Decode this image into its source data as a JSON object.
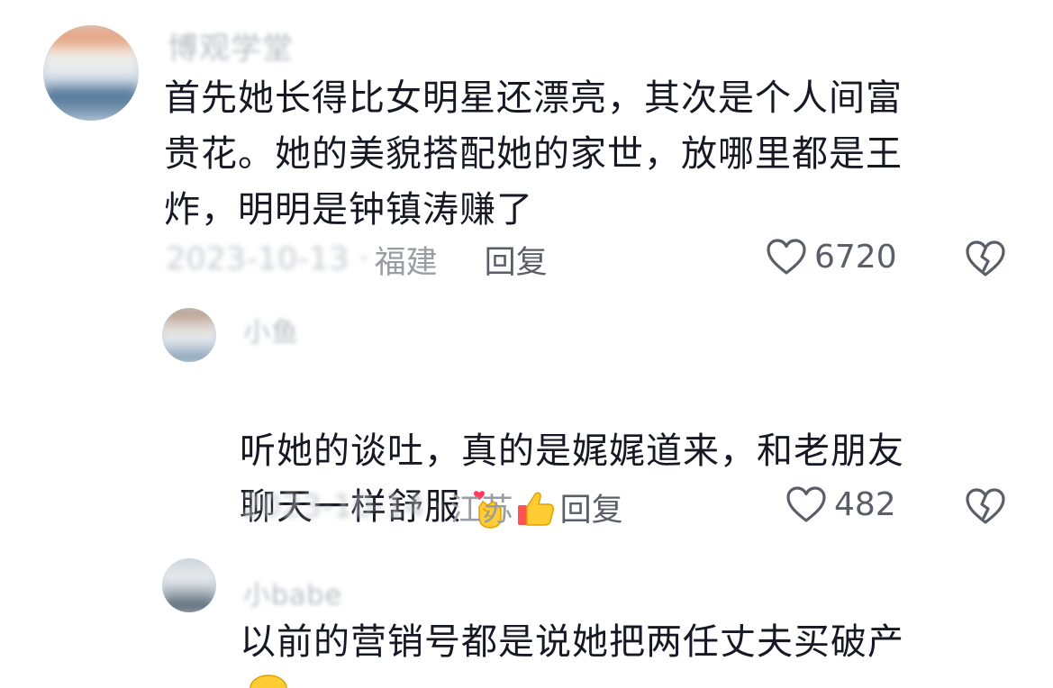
{
  "comments": [
    {
      "username": "博观学堂",
      "text": "首先她长得比女明星还漂亮，其次是个人间富\n贵花。她的美貌搭配她的家世，放哪里都是王\n炸，明明是钟镇涛赚了",
      "date": "2023-10-13 ·",
      "region": "福建",
      "reply_label": "回复",
      "likes": "6720"
    },
    {
      "username": "小鱼",
      "text": "听她的谈吐，真的是娓娓道来，和老朋友\n聊天一样舒服",
      "emojis": [
        "finger-heart-emoji",
        "thumbs-up-emoji"
      ],
      "date": "2023-10-14 ·",
      "region": "江苏",
      "reply_label": "回复",
      "likes": "482"
    },
    {
      "username": "小babe",
      "text": "以前的营销号都是说她把两任丈夫买破产"
    }
  ],
  "colors": {
    "text": "#161823",
    "muted": "#9a9ca3",
    "action": "#5a5e66"
  }
}
